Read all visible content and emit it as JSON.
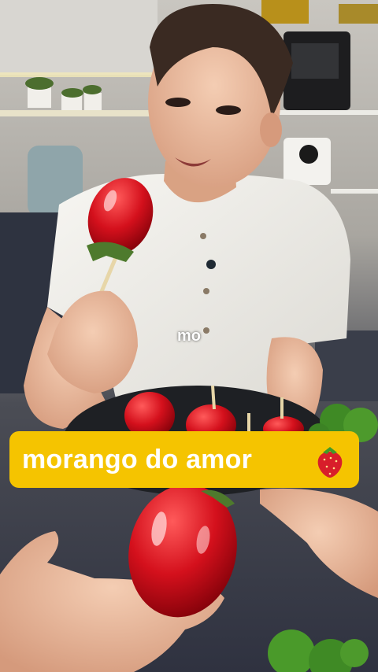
{
  "video_frame": {
    "caption_word": "mo",
    "title_banner": {
      "text": "morango do amor",
      "icon": "strawberry-emoji",
      "background_color": "#f5c400",
      "text_color": "#ffffff"
    }
  }
}
